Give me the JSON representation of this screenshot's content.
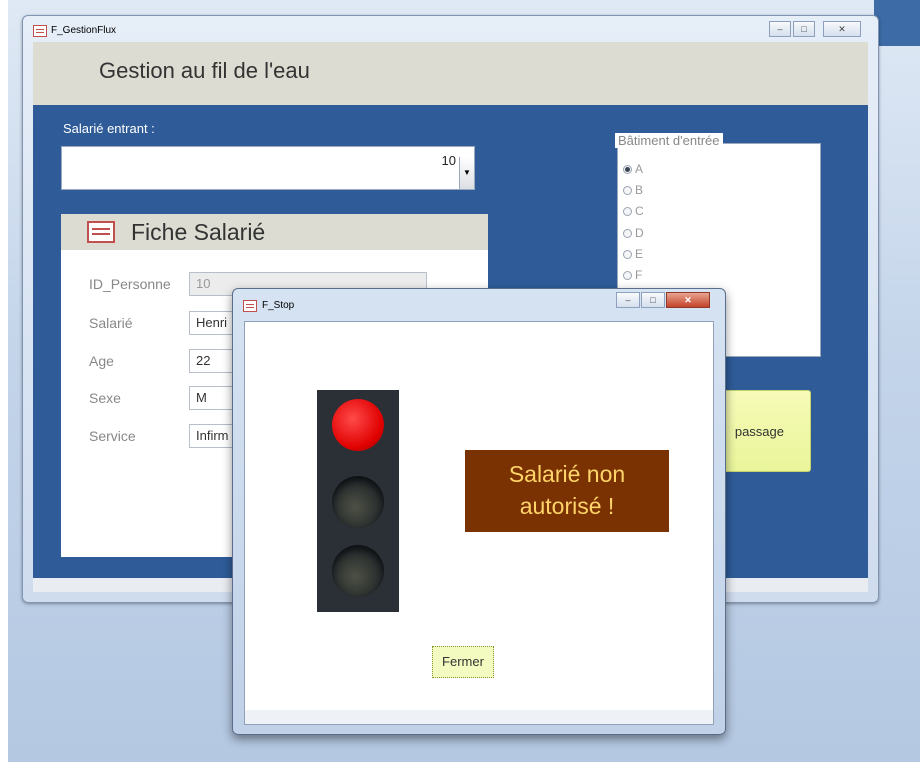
{
  "main_window": {
    "title": "F_GestionFlux",
    "form_title": "Gestion au fil de l'eau",
    "salarie_label": "Salarié entrant :",
    "salarie_value": "10",
    "fiche": {
      "title": "Fiche Salarié",
      "fields": [
        {
          "label": "ID_Personne",
          "value": "10"
        },
        {
          "label": "Salarié",
          "value": "Henri"
        },
        {
          "label": "Age",
          "value": "22"
        },
        {
          "label": "Sexe",
          "value": "M"
        },
        {
          "label": "Service",
          "value": "Infirm"
        }
      ]
    },
    "batiment": {
      "legend": "Bâtiment d'entrée",
      "options": [
        "A",
        "B",
        "C",
        "D",
        "E",
        "F"
      ],
      "selected": "A"
    },
    "passage_button": "passage"
  },
  "dialog": {
    "title": "F_Stop",
    "message_line1": "Salarié non",
    "message_line2": "autorisé !",
    "fermer_button": "Fermer"
  },
  "colors": {
    "form_background": "#2f5c98",
    "header": "#dcdcd2",
    "message_bg": "#7a3202",
    "message_text": "#ffd56a",
    "button_bg": "#f4fbc0"
  }
}
